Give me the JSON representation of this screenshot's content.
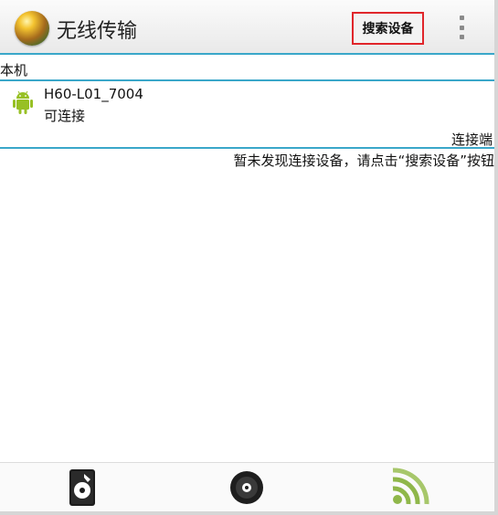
{
  "app": {
    "title": "无线传输",
    "icon": "globe-app-icon"
  },
  "toolbar": {
    "search_label": "搜索设备",
    "menu_icon": "overflow-menu-icon"
  },
  "local": {
    "section_label": "本机",
    "device": {
      "icon": "android-icon",
      "name": "H60-L01_7004",
      "status": "可连接"
    }
  },
  "remote": {
    "section_label": "连接端",
    "empty_message": "暂未发现连接设备，请点击“搜索设备”按钮"
  },
  "tabs": [
    {
      "icon": "music-player-icon"
    },
    {
      "icon": "disc-icon"
    },
    {
      "icon": "wifi-broadcast-icon"
    }
  ],
  "colors": {
    "accent": "#3aa7c9",
    "highlight_border": "#e0262b",
    "android_green": "#97c024"
  }
}
